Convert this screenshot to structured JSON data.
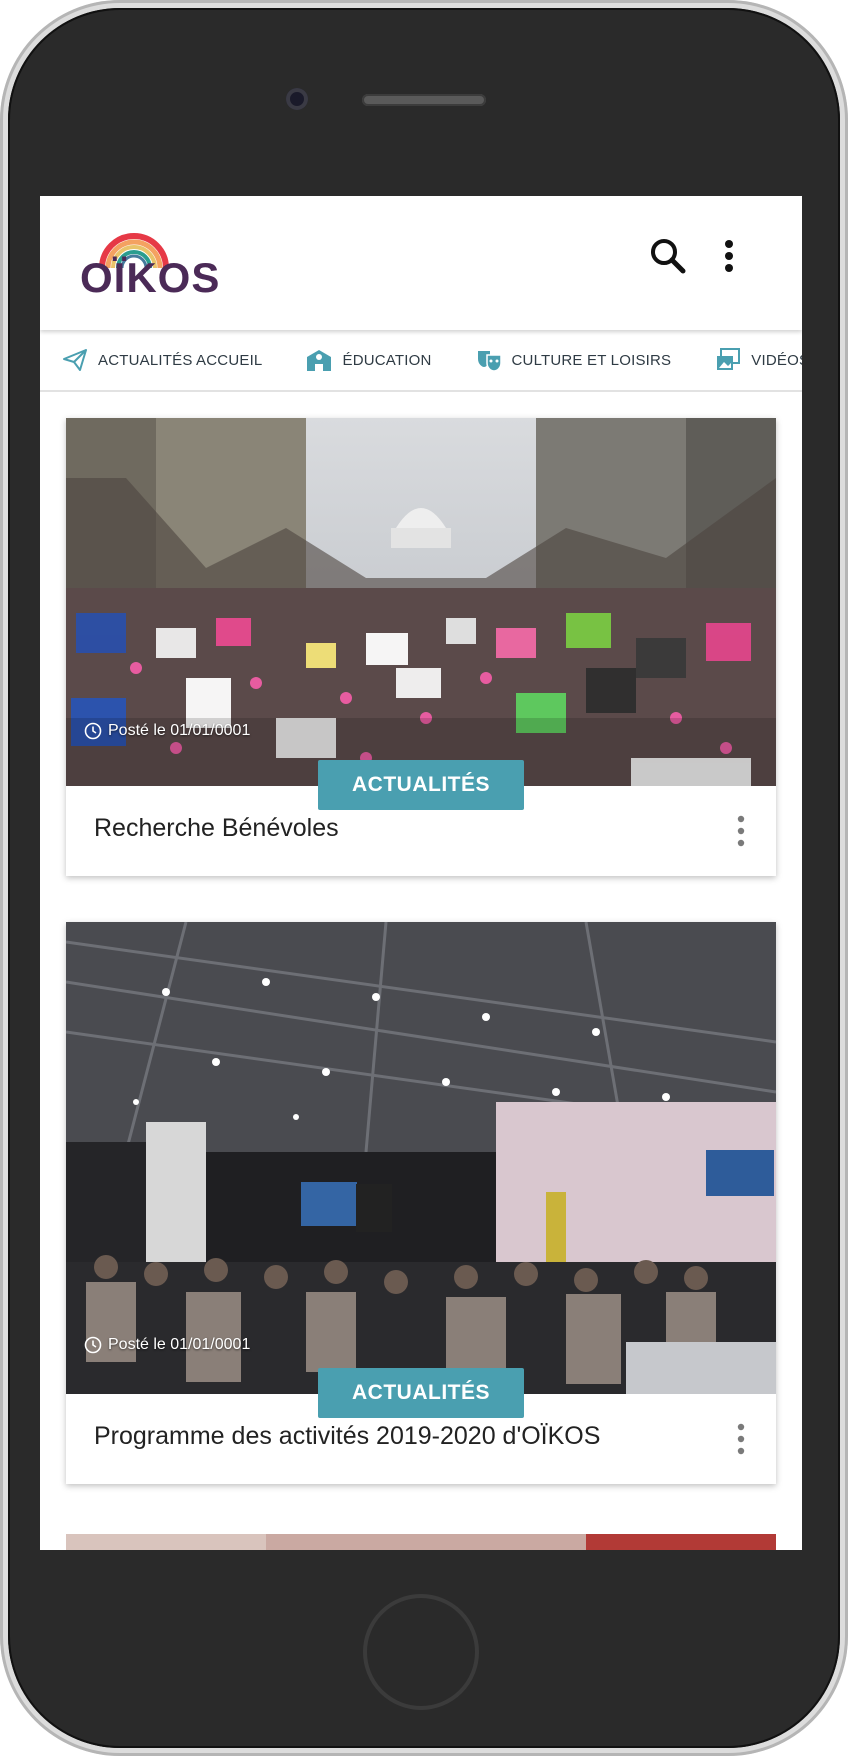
{
  "app": {
    "logo_text": "OÏKOS"
  },
  "nav": {
    "items": [
      {
        "label": "ACTUALITÉS ACCUEIL",
        "icon": "paper-plane-icon"
      },
      {
        "label": "ÉDUCATION",
        "icon": "school-icon"
      },
      {
        "label": "CULTURE ET LOISIRS",
        "icon": "theater-masks-icon"
      },
      {
        "label": "VIDÉOS",
        "icon": "photo-video-icon"
      }
    ]
  },
  "cards": [
    {
      "posted": "Posté le 01/01/0001",
      "tag": "ACTUALITÉS",
      "title": "Recherche Bénévoles"
    },
    {
      "posted": "Posté le 01/01/0001",
      "tag": "ACTUALITÉS",
      "title": "Programme des activités 2019-2020 d'OÏKOS"
    }
  ],
  "colors": {
    "accent": "#4a9fb0",
    "brand": "#4b2a57"
  }
}
